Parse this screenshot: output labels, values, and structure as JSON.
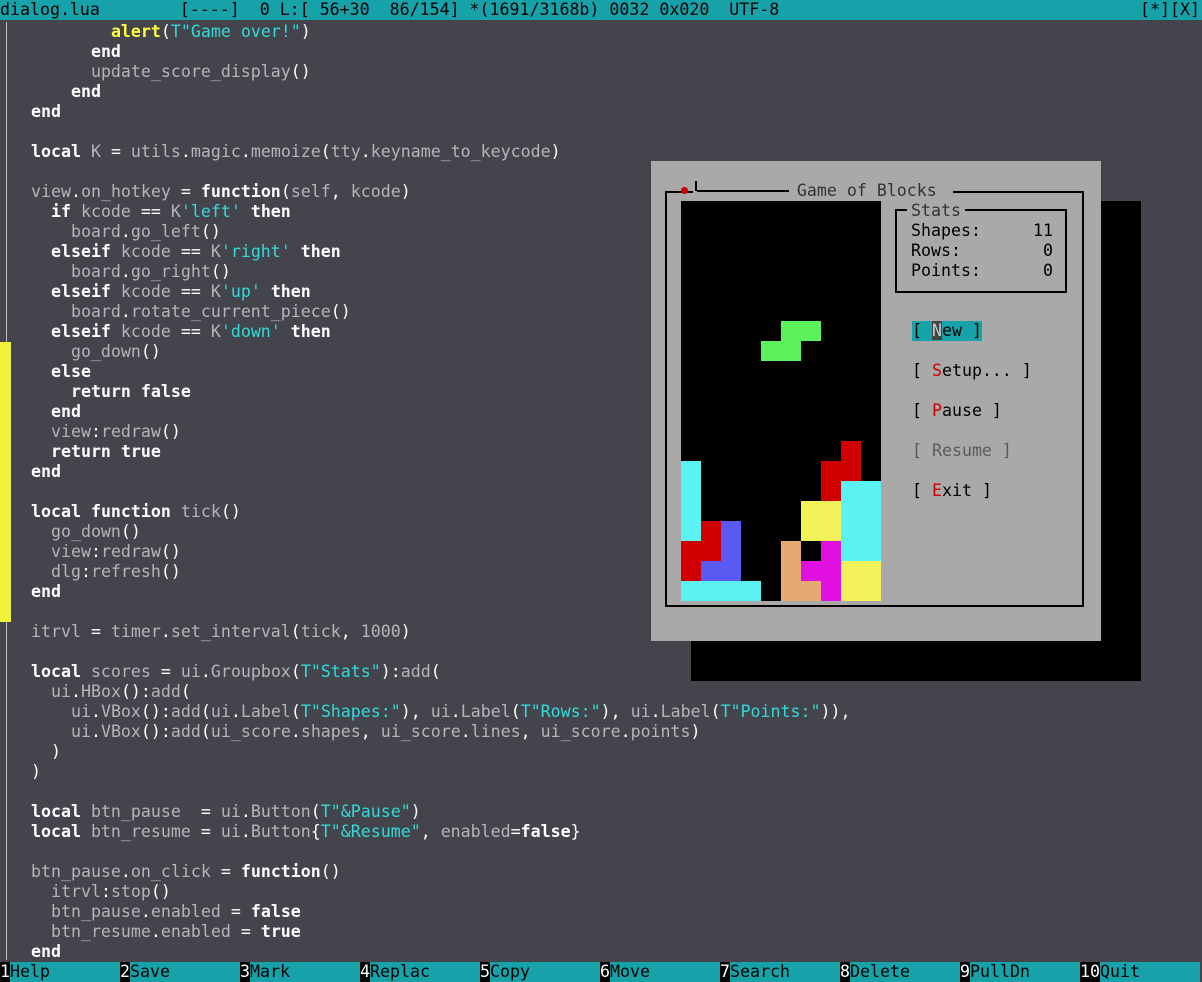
{
  "titlebar": {
    "status": "dialog.lua        [----]  0 L:[ 56+30  86/154] *(1691/3168b) 0032 0x020  UTF-8",
    "right": "[*][X]"
  },
  "code_lines": [
    [
      [
        "        ",
        "v"
      ],
      [
        "alert",
        "y"
      ],
      [
        "(",
        "p"
      ],
      [
        "T",
        "t"
      ],
      [
        "\"Game over!\"",
        "s"
      ],
      [
        ")",
        "p"
      ]
    ],
    [
      [
        "      ",
        "v"
      ],
      [
        "end",
        "k"
      ]
    ],
    [
      [
        "      ",
        "v"
      ],
      [
        "update_score_display",
        "v"
      ],
      [
        "()",
        "p"
      ]
    ],
    [
      [
        "    ",
        "v"
      ],
      [
        "end",
        "k"
      ]
    ],
    [
      [
        "end",
        "k"
      ]
    ],
    [
      [
        "",
        ""
      ]
    ],
    [
      [
        "local",
        "k"
      ],
      [
        " K ",
        "v"
      ],
      [
        "=",
        "p"
      ],
      [
        " utils",
        "v"
      ],
      [
        ".",
        "p"
      ],
      [
        "magic",
        "v"
      ],
      [
        ".",
        "p"
      ],
      [
        "memoize",
        "v"
      ],
      [
        "(",
        "p"
      ],
      [
        "tty",
        "v"
      ],
      [
        ".",
        "p"
      ],
      [
        "keyname_to_keycode",
        "v"
      ],
      [
        ")",
        "p"
      ]
    ],
    [
      [
        "",
        ""
      ]
    ],
    [
      [
        "view",
        "v"
      ],
      [
        ".",
        "p"
      ],
      [
        "on_hotkey ",
        "v"
      ],
      [
        "=",
        "p"
      ],
      [
        " ",
        "v"
      ],
      [
        "function",
        "k"
      ],
      [
        "(",
        "p"
      ],
      [
        "self",
        "v"
      ],
      [
        ",",
        "p"
      ],
      [
        " kcode",
        "v"
      ],
      [
        ")",
        "p"
      ]
    ],
    [
      [
        "  ",
        "v"
      ],
      [
        "if",
        "k"
      ],
      [
        " kcode ",
        "v"
      ],
      [
        "==",
        "p"
      ],
      [
        " K",
        "v"
      ],
      [
        "'left'",
        "s"
      ],
      [
        " ",
        "v"
      ],
      [
        "then",
        "k"
      ]
    ],
    [
      [
        "    board",
        "v"
      ],
      [
        ".",
        "p"
      ],
      [
        "go_left",
        "v"
      ],
      [
        "()",
        "p"
      ]
    ],
    [
      [
        "  ",
        "v"
      ],
      [
        "elseif",
        "k"
      ],
      [
        " kcode ",
        "v"
      ],
      [
        "==",
        "p"
      ],
      [
        " K",
        "v"
      ],
      [
        "'right'",
        "s"
      ],
      [
        " ",
        "v"
      ],
      [
        "then",
        "k"
      ]
    ],
    [
      [
        "    board",
        "v"
      ],
      [
        ".",
        "p"
      ],
      [
        "go_right",
        "v"
      ],
      [
        "()",
        "p"
      ]
    ],
    [
      [
        "  ",
        "v"
      ],
      [
        "elseif",
        "k"
      ],
      [
        " kcode ",
        "v"
      ],
      [
        "==",
        "p"
      ],
      [
        " K",
        "v"
      ],
      [
        "'up'",
        "s"
      ],
      [
        " ",
        "v"
      ],
      [
        "then",
        "k"
      ]
    ],
    [
      [
        "    board",
        "v"
      ],
      [
        ".",
        "p"
      ],
      [
        "rotate_current_piece",
        "v"
      ],
      [
        "()",
        "p"
      ]
    ],
    [
      [
        "  ",
        "v"
      ],
      [
        "elseif",
        "k"
      ],
      [
        " kcode ",
        "v"
      ],
      [
        "==",
        "p"
      ],
      [
        " K",
        "v"
      ],
      [
        "'down'",
        "s"
      ],
      [
        " ",
        "v"
      ],
      [
        "then",
        "k"
      ]
    ],
    [
      [
        "    go_down",
        "v"
      ],
      [
        "()",
        "p"
      ]
    ],
    [
      [
        "  ",
        "v"
      ],
      [
        "else",
        "k"
      ]
    ],
    [
      [
        "    ",
        "v"
      ],
      [
        "return",
        "k"
      ],
      [
        " ",
        "v"
      ],
      [
        "false",
        "k"
      ]
    ],
    [
      [
        "  ",
        "v"
      ],
      [
        "end",
        "k"
      ]
    ],
    [
      [
        "  view",
        "v"
      ],
      [
        ":",
        "p"
      ],
      [
        "redraw",
        "v"
      ],
      [
        "()",
        "p"
      ]
    ],
    [
      [
        "  ",
        "v"
      ],
      [
        "return",
        "k"
      ],
      [
        " ",
        "v"
      ],
      [
        "true",
        "k"
      ]
    ],
    [
      [
        "end",
        "k"
      ]
    ],
    [
      [
        "",
        ""
      ]
    ],
    [
      [
        "local",
        "k"
      ],
      [
        " ",
        "v"
      ],
      [
        "function",
        "k"
      ],
      [
        " tick",
        "v"
      ],
      [
        "()",
        "p"
      ]
    ],
    [
      [
        "  go_down",
        "v"
      ],
      [
        "()",
        "p"
      ]
    ],
    [
      [
        "  view",
        "v"
      ],
      [
        ":",
        "p"
      ],
      [
        "redraw",
        "v"
      ],
      [
        "()",
        "p"
      ]
    ],
    [
      [
        "  dlg",
        "v"
      ],
      [
        ":",
        "p"
      ],
      [
        "refresh",
        "v"
      ],
      [
        "()",
        "p"
      ]
    ],
    [
      [
        "end",
        "k"
      ]
    ],
    [
      [
        "",
        ""
      ]
    ],
    [
      [
        "itrvl ",
        "v"
      ],
      [
        "=",
        "p"
      ],
      [
        " timer",
        "v"
      ],
      [
        ".",
        "p"
      ],
      [
        "set_interval",
        "v"
      ],
      [
        "(",
        "p"
      ],
      [
        "tick",
        "v"
      ],
      [
        ",",
        "p"
      ],
      [
        " 1000",
        "v"
      ],
      [
        ")",
        "p"
      ]
    ],
    [
      [
        "",
        ""
      ]
    ],
    [
      [
        "local",
        "k"
      ],
      [
        " scores ",
        "v"
      ],
      [
        "=",
        "p"
      ],
      [
        " ui",
        "v"
      ],
      [
        ".",
        "p"
      ],
      [
        "Groupbox",
        "v"
      ],
      [
        "(",
        "p"
      ],
      [
        "T",
        "t"
      ],
      [
        "\"Stats\"",
        "s"
      ],
      [
        ")",
        "p"
      ],
      [
        ":",
        "p"
      ],
      [
        "add",
        "v"
      ],
      [
        "(",
        "p"
      ]
    ],
    [
      [
        "  ui",
        "v"
      ],
      [
        ".",
        "p"
      ],
      [
        "HBox",
        "v"
      ],
      [
        "()",
        "p"
      ],
      [
        ":",
        "p"
      ],
      [
        "add",
        "v"
      ],
      [
        "(",
        "p"
      ]
    ],
    [
      [
        "    ui",
        "v"
      ],
      [
        ".",
        "p"
      ],
      [
        "VBox",
        "v"
      ],
      [
        "()",
        "p"
      ],
      [
        ":",
        "p"
      ],
      [
        "add",
        "v"
      ],
      [
        "(",
        "p"
      ],
      [
        "ui",
        "v"
      ],
      [
        ".",
        "p"
      ],
      [
        "Label",
        "v"
      ],
      [
        "(",
        "p"
      ],
      [
        "T",
        "t"
      ],
      [
        "\"Shapes:\"",
        "s"
      ],
      [
        ")",
        "p"
      ],
      [
        ",",
        "p"
      ],
      [
        " ui",
        "v"
      ],
      [
        ".",
        "p"
      ],
      [
        "Label",
        "v"
      ],
      [
        "(",
        "p"
      ],
      [
        "T",
        "t"
      ],
      [
        "\"Rows:\"",
        "s"
      ],
      [
        ")",
        "p"
      ],
      [
        ",",
        "p"
      ],
      [
        " ui",
        "v"
      ],
      [
        ".",
        "p"
      ],
      [
        "Label",
        "v"
      ],
      [
        "(",
        "p"
      ],
      [
        "T",
        "t"
      ],
      [
        "\"Points:\"",
        "s"
      ],
      [
        "))",
        "p"
      ],
      [
        ",",
        "p"
      ]
    ],
    [
      [
        "    ui",
        "v"
      ],
      [
        ".",
        "p"
      ],
      [
        "VBox",
        "v"
      ],
      [
        "()",
        "p"
      ],
      [
        ":",
        "p"
      ],
      [
        "add",
        "v"
      ],
      [
        "(",
        "p"
      ],
      [
        "ui_score",
        "v"
      ],
      [
        ".",
        "p"
      ],
      [
        "shapes",
        "v"
      ],
      [
        ",",
        "p"
      ],
      [
        " ui_score",
        "v"
      ],
      [
        ".",
        "p"
      ],
      [
        "lines",
        "v"
      ],
      [
        ",",
        "p"
      ],
      [
        " ui_score",
        "v"
      ],
      [
        ".",
        "p"
      ],
      [
        "points",
        "v"
      ],
      [
        ")",
        "p"
      ]
    ],
    [
      [
        "  ",
        "v"
      ],
      [
        ")",
        "p"
      ]
    ],
    [
      [
        ")",
        "p"
      ]
    ],
    [
      [
        "",
        ""
      ]
    ],
    [
      [
        "local",
        "k"
      ],
      [
        " btn_pause  ",
        "v"
      ],
      [
        "=",
        "p"
      ],
      [
        " ui",
        "v"
      ],
      [
        ".",
        "p"
      ],
      [
        "Button",
        "v"
      ],
      [
        "(",
        "p"
      ],
      [
        "T",
        "t"
      ],
      [
        "\"&Pause\"",
        "s"
      ],
      [
        ")",
        "p"
      ]
    ],
    [
      [
        "local",
        "k"
      ],
      [
        " btn_resume ",
        "v"
      ],
      [
        "=",
        "p"
      ],
      [
        " ui",
        "v"
      ],
      [
        ".",
        "p"
      ],
      [
        "Button",
        "v"
      ],
      [
        "{",
        "p"
      ],
      [
        "T",
        "t"
      ],
      [
        "\"&Resume\"",
        "s"
      ],
      [
        ",",
        "p"
      ],
      [
        " enabled",
        "v"
      ],
      [
        "=",
        "p"
      ],
      [
        "false",
        "k"
      ],
      [
        "}",
        "p"
      ]
    ],
    [
      [
        "",
        ""
      ]
    ],
    [
      [
        "btn_pause",
        "v"
      ],
      [
        ".",
        "p"
      ],
      [
        "on_click ",
        "v"
      ],
      [
        "=",
        "p"
      ],
      [
        " ",
        "v"
      ],
      [
        "function",
        "k"
      ],
      [
        "()",
        "p"
      ]
    ],
    [
      [
        "  itrvl",
        "v"
      ],
      [
        ":",
        "p"
      ],
      [
        "stop",
        "v"
      ],
      [
        "()",
        "p"
      ]
    ],
    [
      [
        "  btn_pause",
        "v"
      ],
      [
        ".",
        "p"
      ],
      [
        "enabled ",
        "v"
      ],
      [
        "=",
        "p"
      ],
      [
        " ",
        "v"
      ],
      [
        "false",
        "k"
      ]
    ],
    [
      [
        "  btn_resume",
        "v"
      ],
      [
        ".",
        "p"
      ],
      [
        "enabled ",
        "v"
      ],
      [
        "=",
        "p"
      ],
      [
        " ",
        "v"
      ],
      [
        "true",
        "k"
      ]
    ],
    [
      [
        "end",
        "k"
      ]
    ]
  ],
  "dialog": {
    "title": "Game of Blocks",
    "stats": {
      "title": "Stats",
      "shapes_label": "Shapes:",
      "shapes_value": "11",
      "rows_label": "Rows:",
      "rows_value": "0",
      "points_label": "Points:",
      "points_value": "0"
    },
    "buttons": [
      {
        "open": "[ ",
        "hotkey": "N",
        "rest": "ew ]",
        "state": "focused"
      },
      {
        "open": "[ ",
        "hotkey": "S",
        "rest": "etup... ]",
        "state": "normal"
      },
      {
        "open": "[ ",
        "hotkey": "P",
        "rest": "ause ]",
        "state": "normal"
      },
      {
        "open": "[ ",
        "hotkey": "",
        "rest": "Resume ]",
        "state": "disabled"
      },
      {
        "open": "[ ",
        "hotkey": "E",
        "rest": "xit ]",
        "state": "normal"
      }
    ],
    "board": {
      "cols": 10,
      "rows": 20,
      "colors": {
        "green": "#5cf25c",
        "cyan": "#5af2f2",
        "red": "#d00000",
        "blue": "#5a5af2",
        "yellow": "#f2f25a",
        "tan": "#e4aa72",
        "magenta": "#e010e0"
      },
      "cells": [
        [
          5,
          6,
          "green"
        ],
        [
          6,
          6,
          "green"
        ],
        [
          4,
          7,
          "green"
        ],
        [
          5,
          7,
          "green"
        ],
        [
          8,
          12,
          "red"
        ],
        [
          7,
          13,
          "red"
        ],
        [
          8,
          13,
          "red"
        ],
        [
          7,
          14,
          "red"
        ],
        [
          8,
          14,
          "cyan"
        ],
        [
          9,
          14,
          "cyan"
        ],
        [
          8,
          15,
          "cyan"
        ],
        [
          9,
          15,
          "cyan"
        ],
        [
          8,
          16,
          "cyan"
        ],
        [
          9,
          16,
          "cyan"
        ],
        [
          8,
          17,
          "cyan"
        ],
        [
          9,
          17,
          "cyan"
        ],
        [
          6,
          15,
          "yellow"
        ],
        [
          7,
          15,
          "yellow"
        ],
        [
          6,
          16,
          "yellow"
        ],
        [
          7,
          16,
          "yellow"
        ],
        [
          0,
          13,
          "cyan"
        ],
        [
          0,
          14,
          "cyan"
        ],
        [
          0,
          15,
          "cyan"
        ],
        [
          0,
          16,
          "cyan"
        ],
        [
          1,
          16,
          "red"
        ],
        [
          0,
          17,
          "red"
        ],
        [
          1,
          17,
          "red"
        ],
        [
          0,
          18,
          "red"
        ],
        [
          2,
          16,
          "blue"
        ],
        [
          2,
          17,
          "blue"
        ],
        [
          1,
          18,
          "blue"
        ],
        [
          2,
          18,
          "blue"
        ],
        [
          0,
          19,
          "cyan"
        ],
        [
          1,
          19,
          "cyan"
        ],
        [
          2,
          19,
          "cyan"
        ],
        [
          3,
          19,
          "cyan"
        ],
        [
          5,
          17,
          "tan"
        ],
        [
          5,
          18,
          "tan"
        ],
        [
          5,
          19,
          "tan"
        ],
        [
          6,
          19,
          "tan"
        ],
        [
          7,
          17,
          "magenta"
        ],
        [
          6,
          18,
          "magenta"
        ],
        [
          7,
          18,
          "magenta"
        ],
        [
          7,
          19,
          "magenta"
        ],
        [
          8,
          18,
          "yellow"
        ],
        [
          9,
          18,
          "yellow"
        ],
        [
          8,
          19,
          "yellow"
        ],
        [
          9,
          19,
          "yellow"
        ]
      ]
    }
  },
  "keybar": [
    {
      "num": "1",
      "label": "Help"
    },
    {
      "num": "2",
      "label": "Save"
    },
    {
      "num": "3",
      "label": "Mark"
    },
    {
      "num": "4",
      "label": "Replac"
    },
    {
      "num": "5",
      "label": "Copy"
    },
    {
      "num": "6",
      "label": "Move"
    },
    {
      "num": "7",
      "label": "Search"
    },
    {
      "num": "8",
      "label": "Delete"
    },
    {
      "num": "9",
      "label": "PullDn"
    },
    {
      "num": "10",
      "label": "Quit"
    }
  ]
}
